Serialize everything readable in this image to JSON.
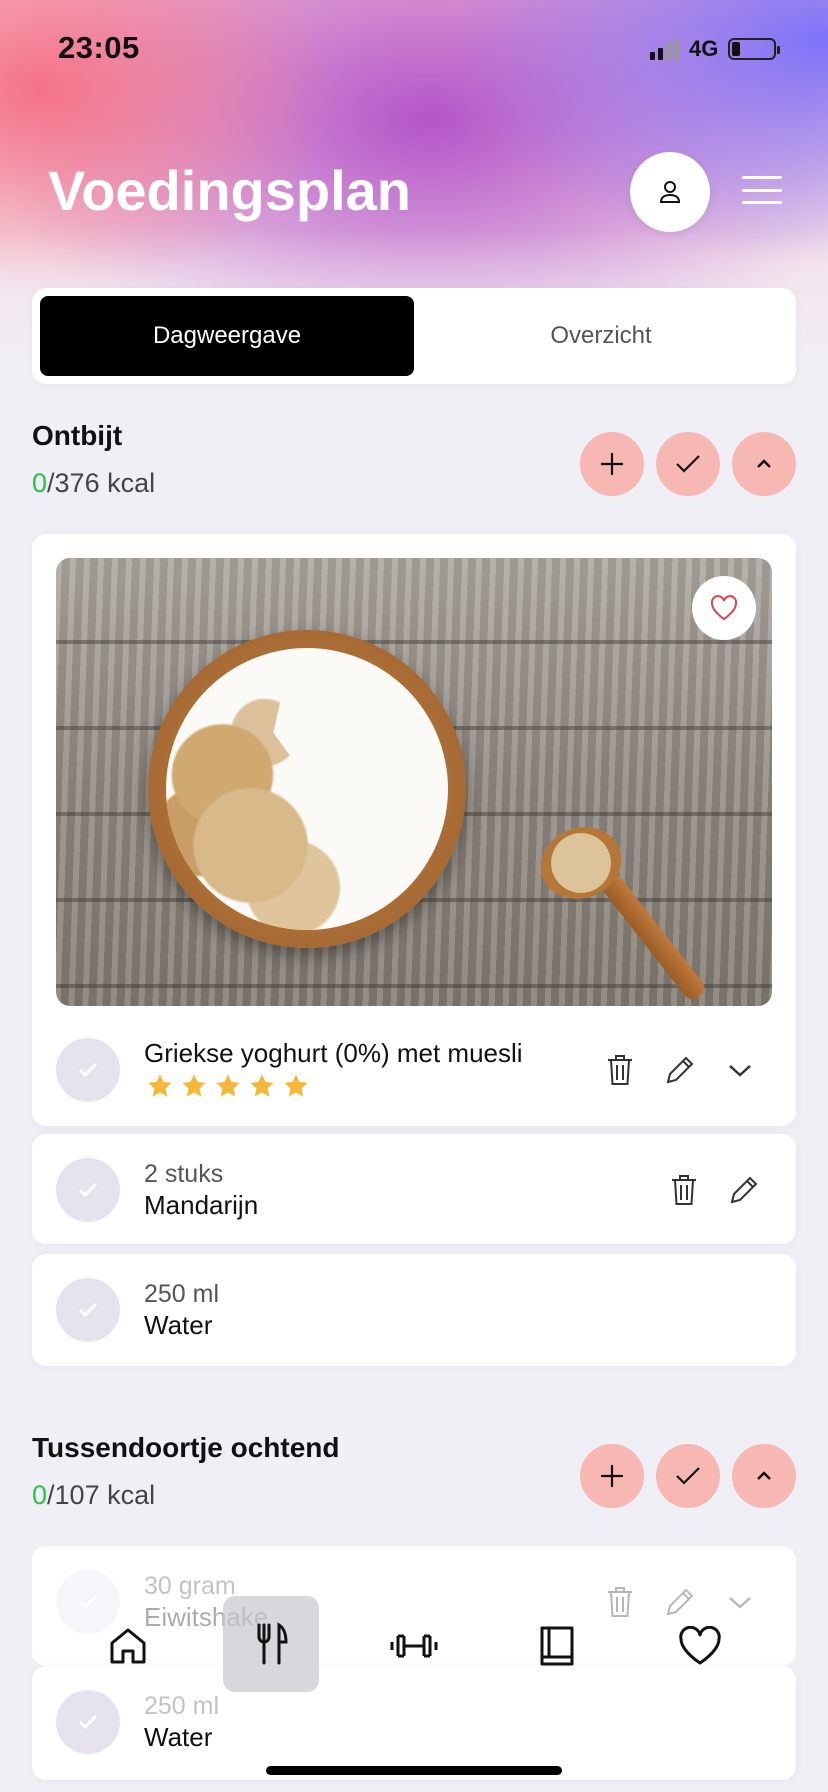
{
  "status": {
    "time": "23:05",
    "network": "4G"
  },
  "header": {
    "title": "Voedingsplan"
  },
  "tabs": [
    {
      "label": "Dagweergave",
      "active": true
    },
    {
      "label": "Overzicht",
      "active": false
    }
  ],
  "breakfast": {
    "title": "Ontbijt",
    "kcal_done": "0",
    "kcal_total": "/376 kcal",
    "main_item": {
      "name": "Griekse yoghurt (0%) met muesli",
      "rating": 5
    },
    "items": [
      {
        "qty": "2 stuks",
        "name": "Mandarijn"
      },
      {
        "qty": "250 ml",
        "name": "Water"
      }
    ]
  },
  "snack": {
    "title": "Tussendoortje ochtend",
    "kcal_done": "0",
    "kcal_total": "/107 kcal",
    "items": [
      {
        "qty": "30 gram",
        "name": "Eiwitshake"
      },
      {
        "qty": "250 ml",
        "name": "Water"
      }
    ]
  },
  "nav": {
    "items": [
      "home-icon",
      "fork-knife-icon",
      "dumbbell-icon",
      "book-icon",
      "heart-icon"
    ],
    "active": "fork-knife-icon"
  },
  "colors": {
    "accent_button": "#f7b8b4",
    "done_kcal": "#2fbf4a",
    "star": "#f5b83a"
  }
}
